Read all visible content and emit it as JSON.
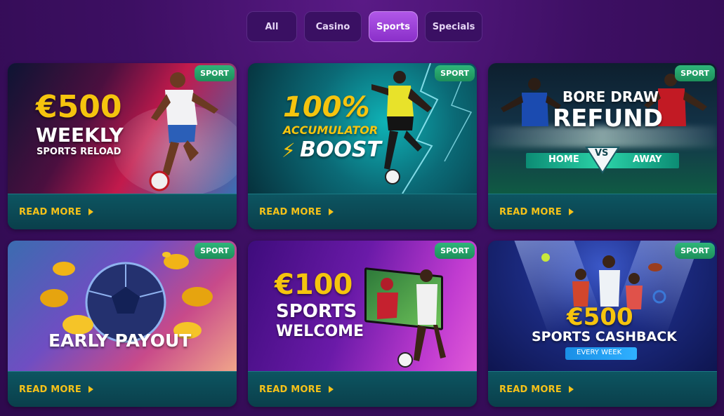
{
  "filters": {
    "all": "All",
    "casino": "Casino",
    "sports": "Sports",
    "specials": "Specials",
    "active": "Sports"
  },
  "colors": {
    "accent": "#a64be0",
    "badge": "#27a56b",
    "read_more": "#f6c219",
    "card_footer": "#0c4b57"
  },
  "cards": [
    {
      "badge": "SPORT",
      "line1": "€500",
      "line2": "WEEKLY",
      "line3": "SPORTS RELOAD",
      "read_more": "READ MORE"
    },
    {
      "badge": "SPORT",
      "line1": "100%",
      "line2": "ACCUMULATOR",
      "line3": "BOOST",
      "read_more": "READ MORE"
    },
    {
      "badge": "SPORT",
      "line1": "BORE DRAW",
      "line2": "REFUND",
      "home": "HOME",
      "vs": "VS",
      "away": "AWAY",
      "read_more": "READ MORE"
    },
    {
      "badge": "SPORT",
      "line1": "EARLY PAYOUT",
      "read_more": "READ MORE"
    },
    {
      "badge": "SPORT",
      "line1": "€100",
      "line2": "SPORTS",
      "line3": "WELCOME",
      "read_more": "READ MORE"
    },
    {
      "badge": "SPORT",
      "line1": "€500",
      "line2": "SPORTS CASHBACK",
      "line3": "EVERY WEEK",
      "read_more": "READ MORE"
    }
  ]
}
